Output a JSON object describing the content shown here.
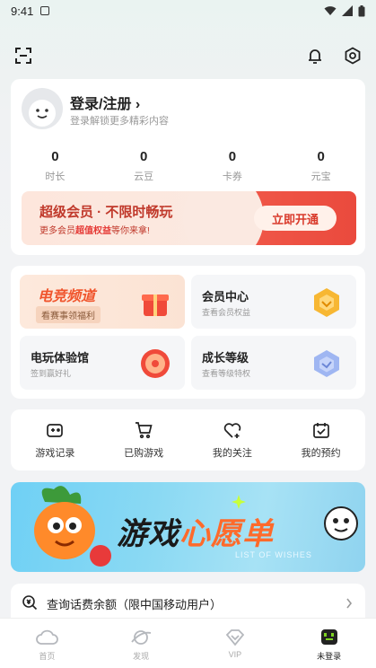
{
  "status_bar": {
    "time": "9:41"
  },
  "profile": {
    "login_title": "登录/注册 ›",
    "login_sub": "登录解锁更多精彩内容",
    "stats": [
      {
        "value": "0",
        "label": "时长"
      },
      {
        "value": "0",
        "label": "云豆"
      },
      {
        "value": "0",
        "label": "卡券"
      },
      {
        "value": "0",
        "label": "元宝"
      }
    ]
  },
  "vip_banner": {
    "title": "超级会员 · 不限时畅玩",
    "sub_prefix": "更多会员",
    "sub_highlight": "超值权益",
    "sub_suffix": "等你来拿!",
    "button": "立即开通"
  },
  "tiles": {
    "esports": {
      "title": "电竞频道",
      "sub": "看赛事领福利"
    },
    "member": {
      "title": "会员中心",
      "sub": "查看会员权益"
    },
    "arcade": {
      "title": "电玩体验馆",
      "sub": "签到赢好礼"
    },
    "level": {
      "title": "成长等级",
      "sub": "查看等级特权"
    }
  },
  "shortcuts": [
    {
      "label": "游戏记录",
      "icon": "gamepad-icon"
    },
    {
      "label": "已购游戏",
      "icon": "cart-icon"
    },
    {
      "label": "我的关注",
      "icon": "heart-plus-icon"
    },
    {
      "label": "我的预约",
      "icon": "calendar-check-icon"
    }
  ],
  "wish_banner": {
    "title_a": "游戏",
    "title_b": "心愿单",
    "en": "LIST OF WISHES"
  },
  "query": {
    "text": "查询话费余额（限中国移动用户）"
  },
  "tabbar": [
    {
      "label": "首页",
      "icon": "cloud-icon"
    },
    {
      "label": "发现",
      "icon": "planet-icon"
    },
    {
      "label": "VIP",
      "icon": "diamond-icon"
    },
    {
      "label": "未登录",
      "icon": "profile-face-icon"
    }
  ],
  "colors": {
    "accent": "#ea4a3d",
    "brand_green": "#7dd321"
  }
}
